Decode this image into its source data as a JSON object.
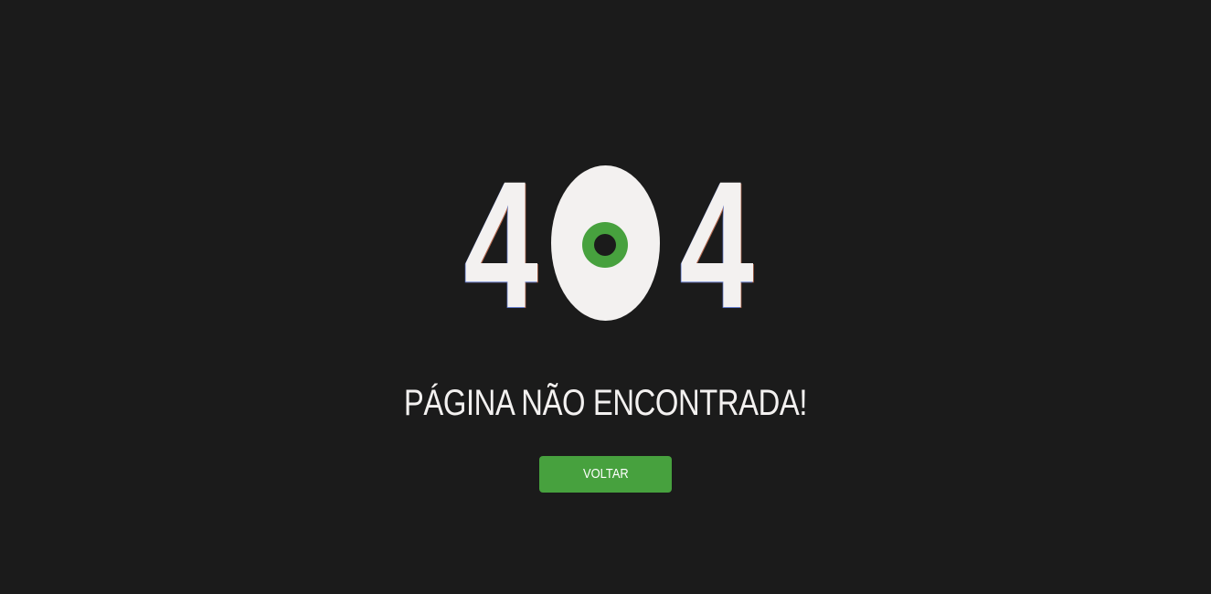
{
  "error_code": {
    "first_digit": "4",
    "last_digit": "4",
    "middle": "0"
  },
  "message": "PÁGINA NÃO ENCONTRADA!",
  "back_button": {
    "label": "VOLTAR"
  },
  "colors": {
    "background": "#1b1b1b",
    "text": "#f3f1f0",
    "accent": "#47a13e"
  }
}
